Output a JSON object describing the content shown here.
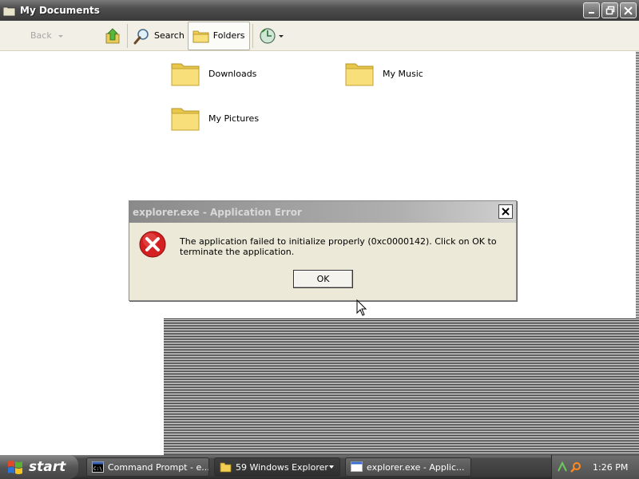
{
  "window": {
    "title": "My Documents",
    "controls": [
      "minimize-icon",
      "restore-icon",
      "close-icon"
    ]
  },
  "toolbar": {
    "back_label": "Back",
    "search_label": "Search",
    "folders_label": "Folders"
  },
  "folders": [
    {
      "label": "Downloads"
    },
    {
      "label": "My Music"
    },
    {
      "label": "My Pictures"
    }
  ],
  "dialog": {
    "title": "explorer.exe - Application Error",
    "message": "The application failed to initialize properly (0xc0000142). Click on OK to terminate the application.",
    "ok_label": "OK",
    "icon": "error-icon"
  },
  "taskbar": {
    "start_label": "start",
    "tasks": [
      {
        "label": "Command Prompt - e...",
        "icon": "cmd-icon"
      },
      {
        "label": "59 Windows Explorer",
        "icon": "folder-icon"
      },
      {
        "label": "explorer.exe - Applic...",
        "icon": "window-icon"
      }
    ],
    "clock": "1:26 PM"
  },
  "colors": {
    "dialog_bg": "#ece9d8",
    "titlebar": "#4e4e4e",
    "error_red": "#d42020",
    "folder_yellow": "#f2d35a"
  }
}
